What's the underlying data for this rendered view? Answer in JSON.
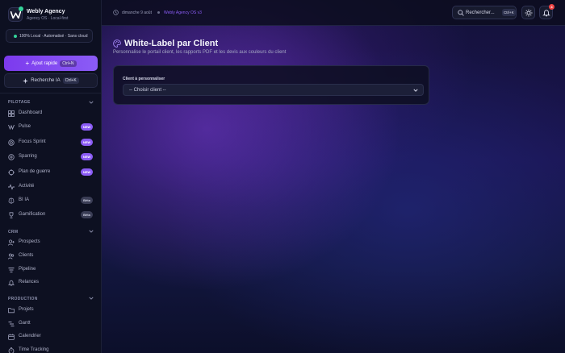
{
  "sidebar": {
    "brand_name": "Webly Agency",
    "brand_sub": "Agency OS · Local-first",
    "status": "100% Local · Automatisé · Sans cloud",
    "quick_add": {
      "label": "Ajout rapide",
      "shortcut": "Ctrl+N"
    },
    "ai_search": {
      "label": "Recherche IA",
      "shortcut": "Ctrl+K"
    },
    "sections": [
      {
        "title": "PILOTAGE",
        "items": [
          {
            "label": "Dashboard",
            "badge": ""
          },
          {
            "label": "Pulse",
            "badge": "NEW"
          },
          {
            "label": "Focus Sprint",
            "badge": "NEW"
          },
          {
            "label": "Sparring",
            "badge": "NEW"
          },
          {
            "label": "Plan de guerre",
            "badge": "NEW"
          },
          {
            "label": "Activité",
            "badge": ""
          },
          {
            "label": "BI IA",
            "badge": "Bêta"
          },
          {
            "label": "Gamification",
            "badge": "Bêta"
          }
        ]
      },
      {
        "title": "CRM",
        "items": [
          {
            "label": "Prospects",
            "badge": ""
          },
          {
            "label": "Clients",
            "badge": ""
          },
          {
            "label": "Pipeline",
            "badge": ""
          },
          {
            "label": "Relances",
            "badge": ""
          }
        ]
      },
      {
        "title": "PRODUCTION",
        "items": [
          {
            "label": "Projets",
            "badge": ""
          },
          {
            "label": "Gantt",
            "badge": ""
          },
          {
            "label": "Calendrier",
            "badge": ""
          },
          {
            "label": "Time Tracking",
            "badge": ""
          }
        ]
      }
    ]
  },
  "topbar": {
    "date": "dimanche 9 août",
    "app_version": "Webly Agency OS v3",
    "search_label": "Rechercher...",
    "search_shortcut": "Ctrl+K",
    "notification_count": "4"
  },
  "page": {
    "title": "White-Label par Client",
    "subtitle": "Personnalise le portail client, les rapports PDF et les devis aux couleurs du client",
    "field_label": "Client à personnaliser",
    "select_value": "-- Choisir client --"
  },
  "colors": {
    "accent": "#8b5cf6",
    "success": "#34d399",
    "danger": "#ef4444"
  }
}
